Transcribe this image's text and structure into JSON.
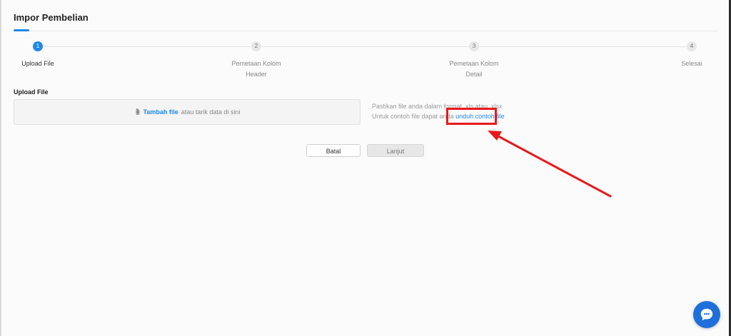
{
  "page": {
    "title": "Impor Pembelian"
  },
  "stepper": {
    "steps": [
      {
        "number": "1",
        "label_line1": "Upload File",
        "label_line2": ""
      },
      {
        "number": "2",
        "label_line1": "Pemetaan Kolom",
        "label_line2": "Header"
      },
      {
        "number": "3",
        "label_line1": "Pemetaan Kolom",
        "label_line2": "Detail"
      },
      {
        "number": "4",
        "label_line1": "Selesai",
        "label_line2": ""
      }
    ],
    "active_step": 1
  },
  "upload": {
    "section_label": "Upload File",
    "add_file_label": "Tambah file",
    "drop_text": "atau tarik data di sini"
  },
  "hint": {
    "line1": "Pastikan file anda dalam format .xls atau .xlsx",
    "line2_prefix": "Untuk contoh file dapat anda",
    "download_link": "unduh contoh file"
  },
  "actions": {
    "cancel_label": "Batal",
    "next_label": "Lanjut"
  },
  "colors": {
    "accent": "#1e88e5",
    "annotation": "#e8191b",
    "chat_button": "#1e6fd9"
  },
  "icons": {
    "attach": "paperclip-icon",
    "chat": "chat-bubble-icon"
  }
}
